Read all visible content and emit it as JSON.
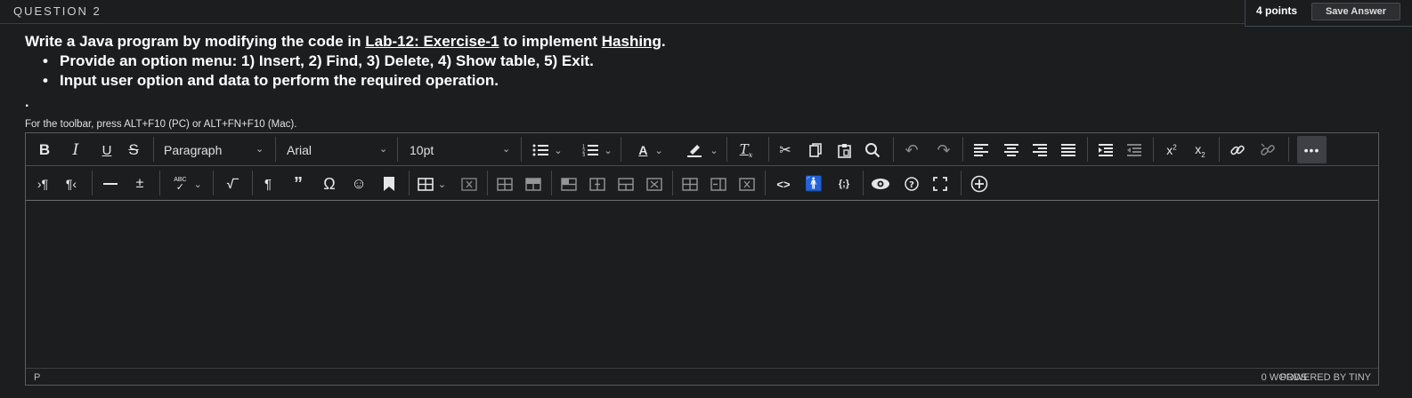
{
  "question": {
    "title": "QUESTION 2",
    "points": "4 points",
    "save_label": "Save Answer"
  },
  "prompt": {
    "pre": "Write a Java program by modifying the code in ",
    "link1": "Lab-12: Exercise-1",
    "mid": " to implement ",
    "link2": "Hashing",
    "end": ".",
    "bullets": [
      "Provide an option menu:  1) Insert, 2) Find, 3) Delete, 4) Show table, 5) Exit.",
      "Input user option and data to perform the required operation."
    ],
    "trailing_bullet": "."
  },
  "editor": {
    "hint": "For the toolbar, press ALT+F10 (PC) or ALT+FN+F10 (Mac).",
    "block_format": "Paragraph",
    "font_family": "Arial",
    "font_size": "10pt",
    "bold": "B",
    "italic": "I",
    "underline": "U",
    "strike": "S",
    "spellcheck_label": "ABC",
    "status_path": "P",
    "word_count": "0 WORDS",
    "powered_by": "POWERED BY TINY",
    "more_label": "•••"
  }
}
